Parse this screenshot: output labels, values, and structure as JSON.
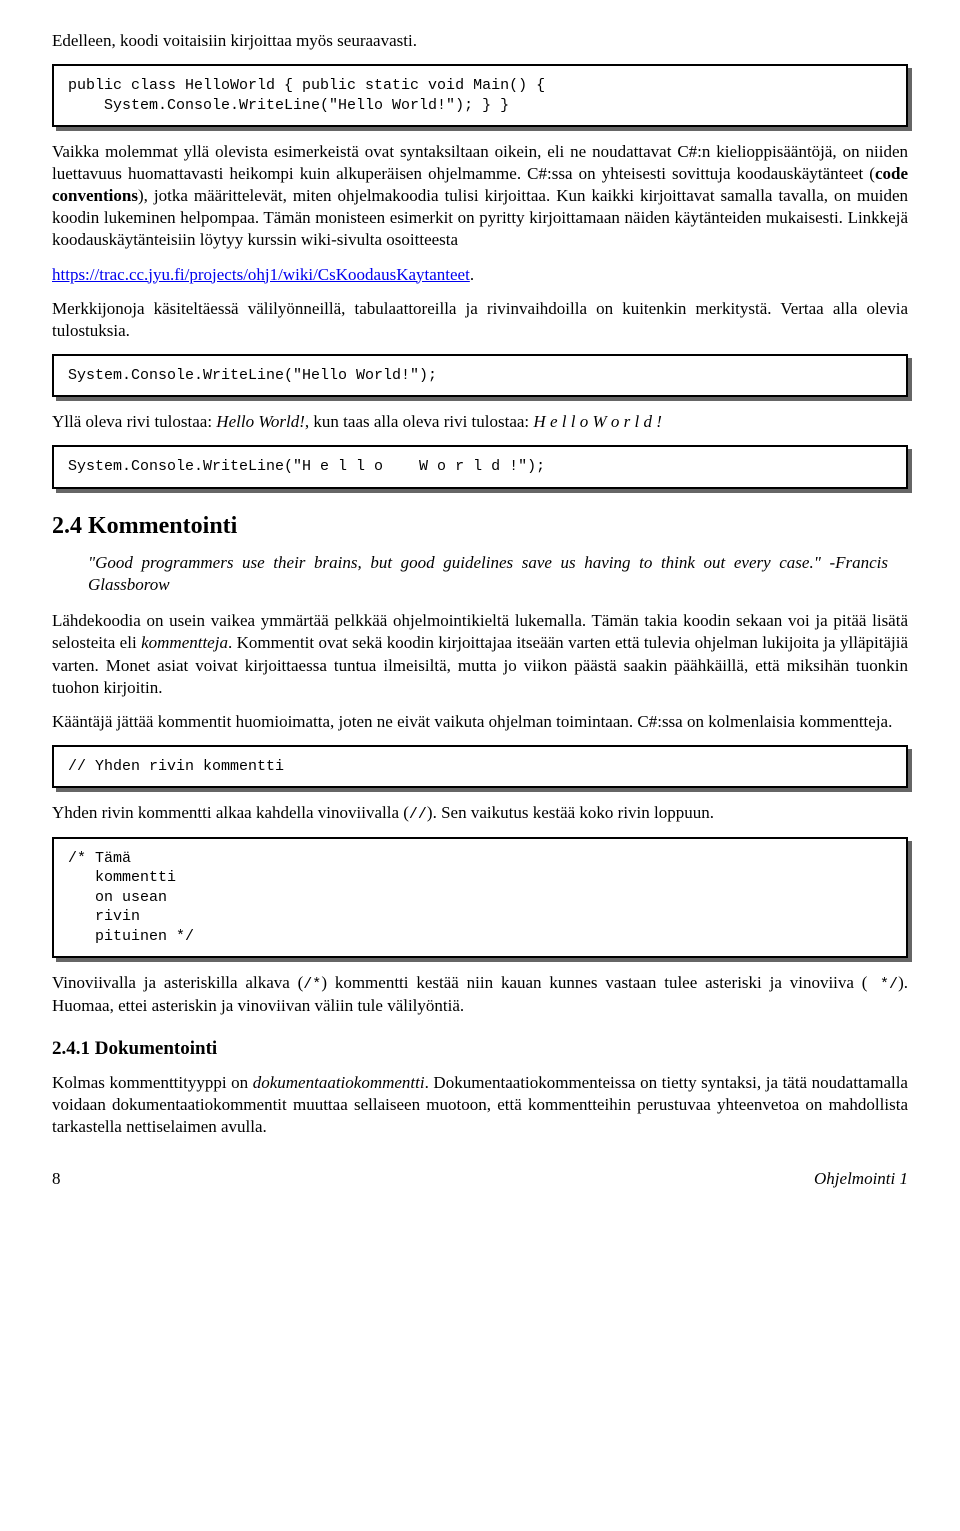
{
  "p1": "Edelleen, koodi voitaisiin kirjoittaa myös seuraavasti.",
  "code1": "public class HelloWorld { public static void Main() {\n    System.Console.WriteLine(\"Hello World!\"); } }",
  "p2a": "Vaikka molemmat yllä olevista esimerkeistä ovat syntaksiltaan oikein, eli ne noudattavat C#:n kielioppisääntöjä, on niiden luettavuus huomattavasti heikompi kuin alkuperäisen ohjelmamme. C#:ssa on yhteisesti sovittuja koodauskäytänteet (",
  "p2b": "code conventions",
  "p2c": "), jotka määrittelevät, miten ohjelmakoodia tulisi kirjoittaa. Kun kaikki kirjoittavat samalla tavalla, on muiden koodin lukeminen helpompaa. Tämän monisteen esimerkit on pyritty kirjoittamaan näiden käytänteiden mukaisesti. Linkkejä koodauskäytänteisiin löytyy kurssin wiki-sivulta osoitteesta",
  "link1": "https://trac.cc.jyu.fi/projects/ohj1/wiki/CsKoodausKaytanteet",
  "p3": "Merkkijonoja käsiteltäessä välilyönneillä, tabulaattoreilla ja rivinvaihdoilla on kuitenkin merkitystä. Vertaa alla olevia tulostuksia.",
  "code2": "System.Console.WriteLine(\"Hello World!\");",
  "p4a": "Yllä oleva rivi tulostaa: ",
  "p4b": "Hello World!",
  "p4c": ", kun taas alla oleva rivi tulostaa: ",
  "p4d": "H e l l o    W o r l d !",
  "code3": "System.Console.WriteLine(\"H e l l o    W o r l d !\");",
  "h2": "2.4   Kommentointi",
  "quote": "\"Good programmers use their brains, but good guidelines save us having to think out every case.\"  -Francis Glassborow",
  "p5a": "Lähdekoodia on usein vaikea ymmärtää pelkkää ohjelmointikieltä lukemalla. Tämän takia koodin sekaan voi ja pitää lisätä selosteita eli ",
  "p5b": "kommentteja",
  "p5c": ". Kommentit ovat sekä koodin kirjoittajaa itseään varten että tulevia ohjelman lukijoita ja ylläpitäjiä varten. Monet asiat voivat kirjoittaessa tuntua ilmeisiltä, mutta jo viikon päästä saakin päähkäillä, että miksihän tuonkin tuohon kirjoitin.",
  "p6": "Kääntäjä jättää kommentit huomioimatta, joten ne eivät vaikuta ohjelman toimintaan. C#:ssa on kolmenlaisia kommentteja.",
  "code4": "// Yhden rivin kommentti",
  "p7a": "Yhden rivin kommentti alkaa kahdella vinoviivalla (",
  "p7b": "//",
  "p7c": "). Sen vaikutus kestää koko rivin loppuun.",
  "code5": "/* Tämä\n   kommentti\n   on usean\n   rivin\n   pituinen */",
  "p8a": "Vinoviivalla ja asteriskilla alkava (",
  "p8b": "/*",
  "p8c": ") kommentti kestää niin kauan kunnes vastaan tulee asteriski ja vinoviiva (",
  "p8d": " */",
  "p8e": "). Huomaa, ettei asteriskin ja vinoviivan väliin tule välilyöntiä.",
  "h3": "2.4.1   Dokumentointi",
  "p9a": "Kolmas kommenttityyppi on ",
  "p9b": "dokumentaatiokommentti",
  "p9c": ". Dokumentaatiokommenteissa on tietty syntaksi, ja tätä noudattamalla voidaan dokumentaatiokommentit muuttaa sellaiseen muotoon, että kommentteihin perustuvaa yhteenvetoa on mahdollista tarkastella nettiselaimen avulla.",
  "footer_left": "8",
  "footer_right": "Ohjelmointi 1"
}
